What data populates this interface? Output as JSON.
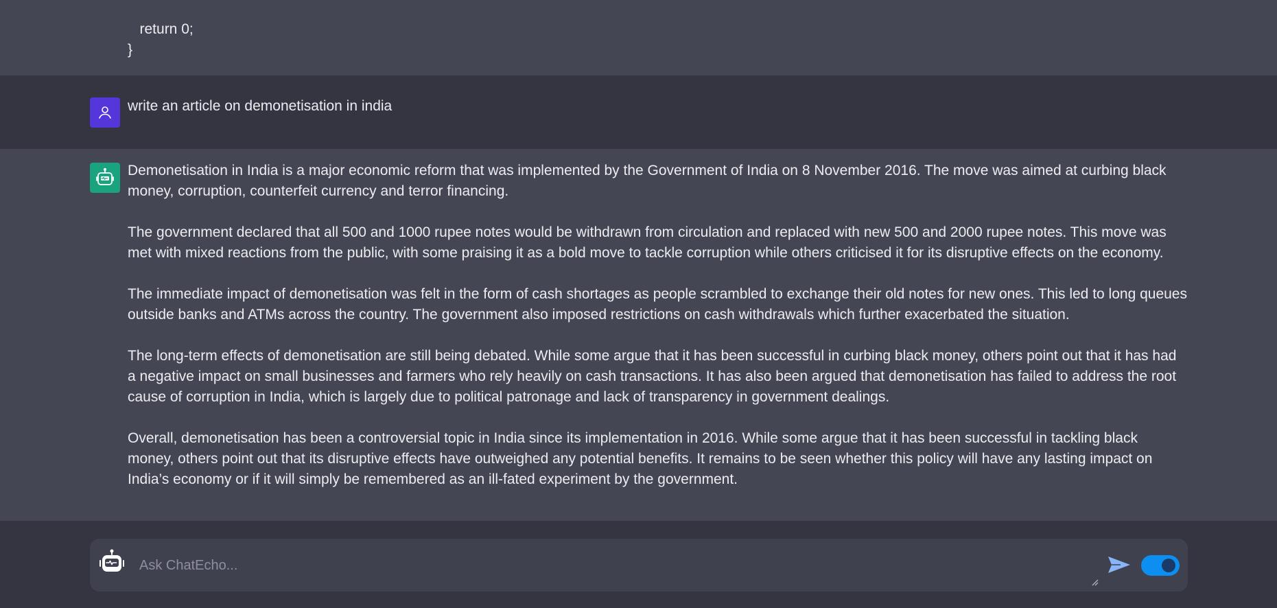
{
  "code_tail": {
    "lines": [
      "   return 0;",
      "}"
    ]
  },
  "user_message": {
    "text": "write an article on demonetisation in india",
    "avatar_icon": "user-icon"
  },
  "bot_message": {
    "avatar_icon": "robot-icon",
    "paragraphs": [
      " Demonetisation in India is a major economic reform that was implemented by the Government of India on 8 November 2016. The move was aimed at curbing black money, corruption, counterfeit currency and terror financing.",
      "The government declared that all 500 and 1000 rupee notes would be withdrawn from circulation and replaced with new 500 and 2000 rupee notes. This move was met with mixed reactions from the public, with some praising it as a bold move to tackle corruption while others criticised it for its disruptive effects on the economy.",
      "The immediate impact of demonetisation was felt in the form of cash shortages as people scrambled to exchange their old notes for new ones. This led to long queues outside banks and ATMs across the country. The government also imposed restrictions on cash withdrawals which further exacerbated the situation.",
      "The long-term effects of demonetisation are still being debated. While some argue that it has been successful in curbing black money, others point out that it has had a negative impact on small businesses and farmers who rely heavily on cash transactions. It has also been argued that demonetisation has failed to address the root cause of corruption in India, which is largely due to political patronage and lack of transparency in government dealings.",
      "Overall, demonetisation has been a controversial topic in India since its implementation in 2016. While some argue that it has been successful in tackling black money, others point out that its disruptive effects have outweighed any potential benefits. It remains to be seen whether this policy will have any lasting impact on India’s economy or if it will simply be remembered as an ill-fated experiment by the government."
    ]
  },
  "composer": {
    "placeholder": "Ask ChatEcho...",
    "value": "",
    "toggle_on": true
  },
  "colors": {
    "user_avatar": "#5436da",
    "bot_avatar": "#19a37f",
    "toggle": "#0d8ff2",
    "send_icon": "#8ab4f8"
  }
}
